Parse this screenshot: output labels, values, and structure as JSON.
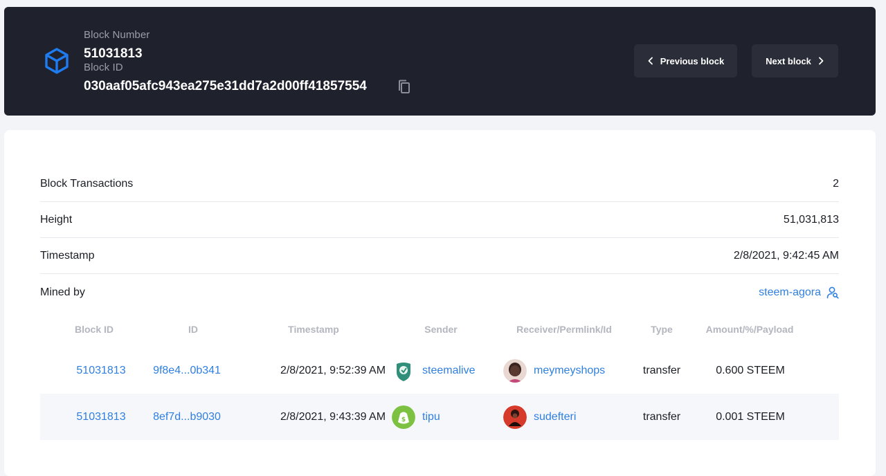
{
  "block": {
    "number_label": "Block Number",
    "number": "51031813",
    "id_label": "Block ID",
    "id": "030aaf05afc943ea275e31dd7a2d00ff41857554"
  },
  "nav": {
    "previous": "Previous block",
    "next": "Next block"
  },
  "info": {
    "transactions_label": "Block Transactions",
    "transactions_value": "2",
    "height_label": "Height",
    "height_value": "51,031,813",
    "timestamp_label": "Timestamp",
    "timestamp_value": "2/8/2021, 9:42:45 AM",
    "mined_by_label": "Mined by",
    "mined_by_value": "steem-agora"
  },
  "table": {
    "headers": [
      "Block ID",
      "ID",
      "Timestamp",
      "Sender",
      "Receiver/Permlink/Id",
      "Type",
      "Amount/%/Payload"
    ],
    "rows": [
      {
        "block_id": "51031813",
        "id": "9f8e4...0b341",
        "timestamp": "2/8/2021, 9:52:39 AM",
        "sender": "steemalive",
        "receiver": "meymeyshops",
        "type": "transfer",
        "amount": "0.600 STEEM"
      },
      {
        "block_id": "51031813",
        "id": "8ef7d...b9030",
        "timestamp": "2/8/2021, 9:43:39 AM",
        "sender": "tipu",
        "receiver": "sudefteri",
        "type": "transfer",
        "amount": "0.001 STEEM"
      }
    ]
  },
  "icons": {
    "block": "cube-icon",
    "copy": "copy-icon",
    "prev": "chevron-left-icon",
    "next": "chevron-right-icon",
    "miner": "user-search-icon"
  },
  "colors": {
    "header_bg": "#1f222c",
    "accent": "#2f7fe0",
    "link": "#2f7fe0"
  }
}
